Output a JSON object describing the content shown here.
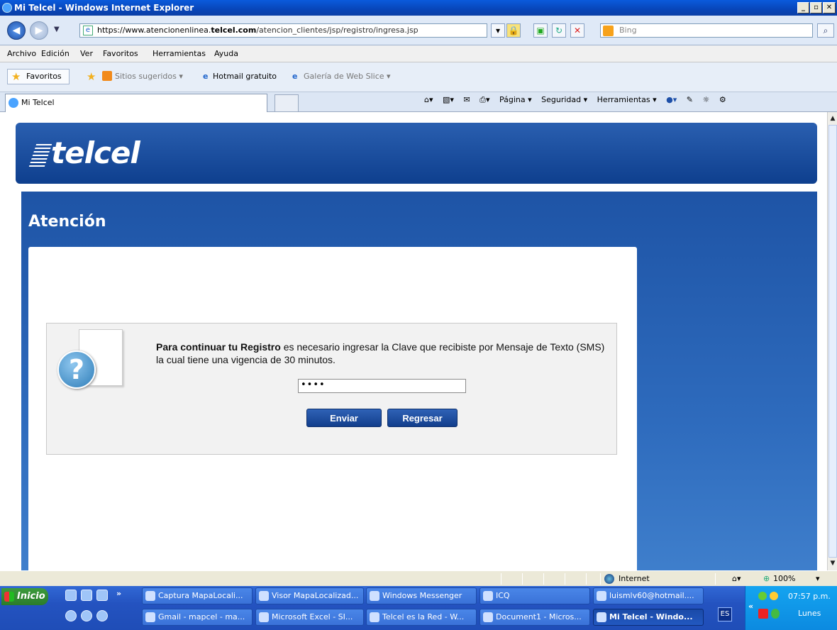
{
  "window": {
    "title": "Mi Telcel - Windows Internet Explorer"
  },
  "address": {
    "prefix": "https://www.atencionenlinea.",
    "domain": "telcel.com",
    "path": "/atencion_clientes/jsp/registro/ingresa.jsp"
  },
  "search": {
    "placeholder": "Bing"
  },
  "menu": [
    "Archivo",
    "Edición",
    "Ver",
    "Favoritos",
    "Herramientas",
    "Ayuda"
  ],
  "favorites": {
    "label": "Favoritos",
    "items": [
      "Sitios sugeridos ▾",
      "Hotmail gratuito",
      "Galería de Web Slice ▾"
    ]
  },
  "tab": {
    "label": "Mi Telcel"
  },
  "commandbar": [
    "Página ▾",
    "Seguridad ▾",
    "Herramientas ▾"
  ],
  "page": {
    "logo": "telcel",
    "heading": "Atención",
    "message_bold": "Para continuar tu Registro",
    "message_rest": " es necesario ingresar la Clave que recibiste por Mensaje de Texto (SMS) la cual tiene una vigencia de 30 minutos.",
    "password_value": "••••",
    "send_button": "Enviar",
    "back_button": "Regresar"
  },
  "status": {
    "zone": "Internet",
    "zoom": "100%"
  },
  "taskbar": {
    "start": "Inicio",
    "tasks_top": [
      "Captura MapaLocali...",
      "Visor MapaLocalizad...",
      "Windows Messenger",
      "ICQ",
      "luismlv60@hotmail...."
    ],
    "tasks_bottom": [
      "Gmail - mapcel - ma...",
      "Microsoft Excel - SI...",
      "Telcel es la Red - W...",
      "Document1 - Micros...",
      "Mi Telcel - Windo..."
    ],
    "lang": "ES",
    "time": "07:57 p.m.",
    "day": "Lunes"
  },
  "colors": {
    "brand_blue": "#1e54a6",
    "button_blue": "#123e8c"
  }
}
